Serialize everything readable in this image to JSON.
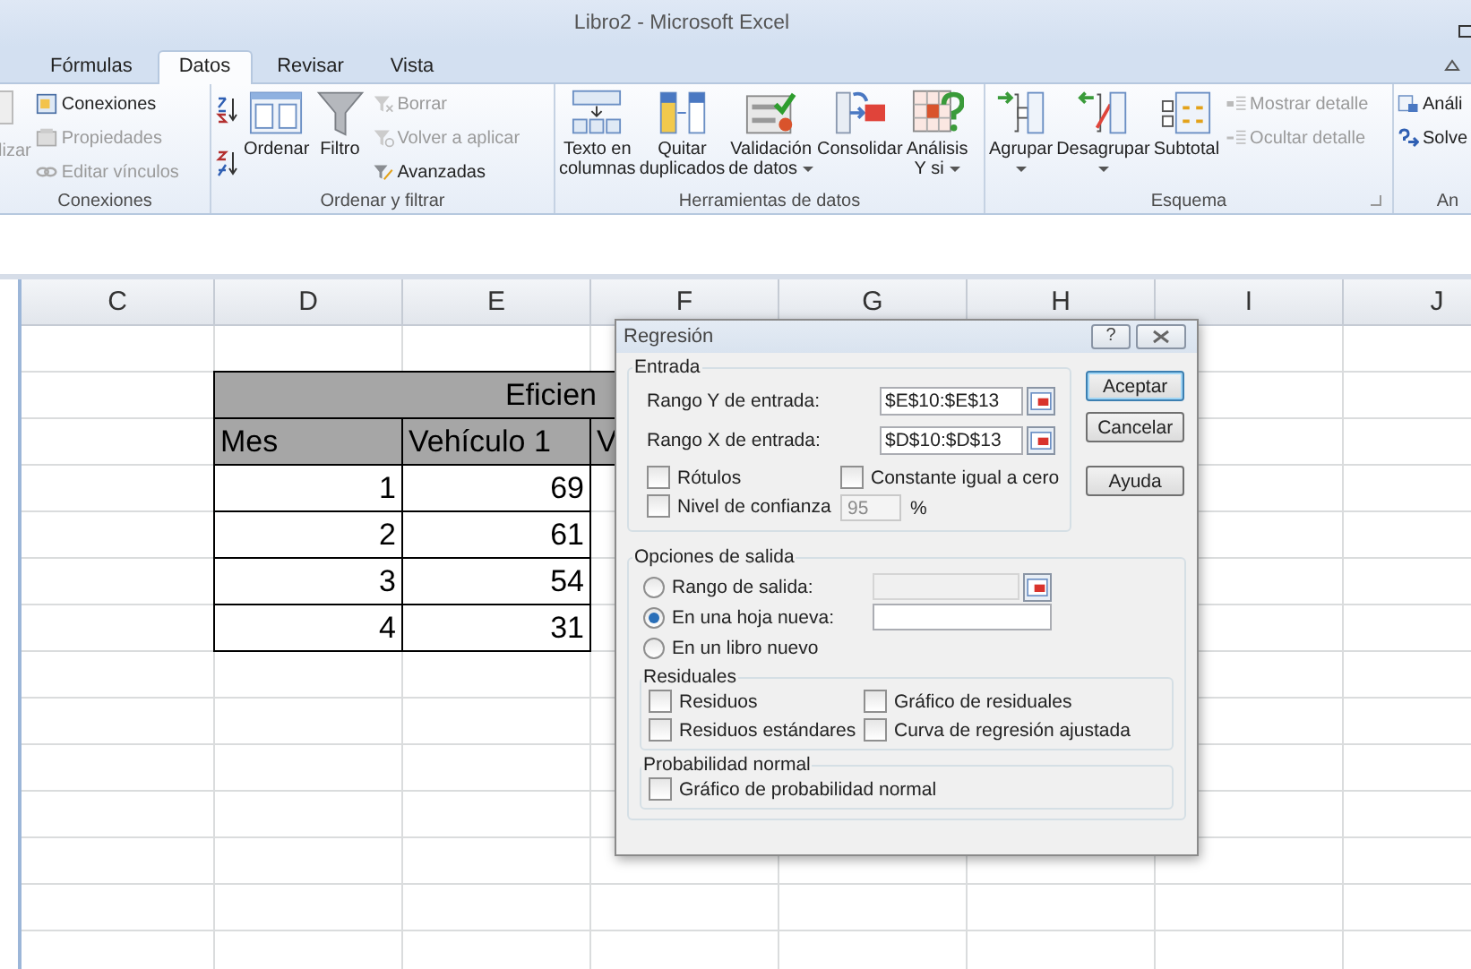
{
  "window": {
    "title": "Libro2  -  Microsoft Excel"
  },
  "tabs": [
    {
      "label": "Fórmulas",
      "selected": false
    },
    {
      "label": "Datos",
      "selected": true
    },
    {
      "label": "Revisar",
      "selected": false
    },
    {
      "label": "Vista",
      "selected": false
    }
  ],
  "ribbon": {
    "groups": [
      {
        "label": "Conexiones",
        "items": [
          {
            "kind": "cut",
            "label": "lizar"
          },
          {
            "kind": "small",
            "label": "Conexiones",
            "disabled": false
          },
          {
            "kind": "small",
            "label": "Propiedades",
            "disabled": true
          },
          {
            "kind": "small",
            "label": "Editar vínculos",
            "disabled": true
          }
        ]
      },
      {
        "label": "Ordenar y filtrar",
        "items": [
          {
            "kind": "sort"
          },
          {
            "kind": "large",
            "label": "Ordenar",
            "dropdown": false
          },
          {
            "kind": "large",
            "label": "Filtro",
            "dropdown": false
          },
          {
            "kind": "small",
            "label": "Borrar",
            "disabled": true
          },
          {
            "kind": "small",
            "label": "Volver a aplicar",
            "disabled": true
          },
          {
            "kind": "small",
            "label": "Avanzadas",
            "disabled": false
          }
        ]
      },
      {
        "label": "Herramientas de datos",
        "items": [
          {
            "kind": "large",
            "label": "Texto en\ncolumnas",
            "dropdown": false
          },
          {
            "kind": "large",
            "label": "Quitar\nduplicados",
            "dropdown": false
          },
          {
            "kind": "large",
            "label": "Validación\nde datos",
            "dropdown": true
          },
          {
            "kind": "large",
            "label": "Consolidar",
            "dropdown": false
          },
          {
            "kind": "large",
            "label": "Análisis\nY si",
            "dropdown": true
          }
        ]
      },
      {
        "label": "Esquema",
        "launcher": true,
        "items": [
          {
            "kind": "large",
            "label": "Agrupar",
            "dropdown": true
          },
          {
            "kind": "large",
            "label": "Desagrupar",
            "dropdown": true
          },
          {
            "kind": "large",
            "label": "Subtotal",
            "dropdown": false
          },
          {
            "kind": "small",
            "label": "Mostrar detalle",
            "disabled": true
          },
          {
            "kind": "small",
            "label": "Ocultar detalle",
            "disabled": true
          }
        ]
      },
      {
        "label": "An",
        "items": [
          {
            "kind": "small",
            "label": "Análi",
            "disabled": false
          },
          {
            "kind": "small",
            "label": "Solve",
            "disabled": false
          }
        ]
      }
    ]
  },
  "sheet": {
    "columns": [
      "C",
      "D",
      "E",
      "F",
      "G",
      "H",
      "I",
      "J"
    ],
    "table": {
      "title": "Eficien",
      "headers": [
        "Mes",
        "Vehículo 1",
        "V"
      ],
      "rows": [
        [
          "1",
          "69"
        ],
        [
          "2",
          "61"
        ],
        [
          "3",
          "54"
        ],
        [
          "4",
          "31"
        ]
      ]
    }
  },
  "dialog": {
    "title": "Regresión",
    "help": "?",
    "input": {
      "label": "Entrada",
      "ranges": [
        {
          "label": "Rango Y de entrada:",
          "value": "$E$10:$E$13"
        },
        {
          "label": "Rango X de entrada:",
          "value": "$D$10:$D$13"
        }
      ],
      "options": [
        {
          "label": "Rótulos",
          "checked": false
        },
        {
          "label": "Constante igual a cero",
          "checked": false
        },
        {
          "label": "Nivel de confianza",
          "checked": false
        }
      ],
      "confidence": {
        "value": "95",
        "disabled": true,
        "unit": "%"
      }
    },
    "buttons": [
      {
        "label": "Aceptar",
        "default": true
      },
      {
        "label": "Cancelar",
        "default": false
      },
      {
        "label": "Ayuda",
        "default": false
      }
    ],
    "output": {
      "label": "Opciones de salida",
      "choices": [
        {
          "label": "Rango de salida:",
          "selected": false,
          "kind": "range",
          "disabled": true
        },
        {
          "label": "En una hoja nueva:",
          "selected": true,
          "kind": "text",
          "disabled": false
        },
        {
          "label": "En un libro nuevo",
          "selected": false
        }
      ],
      "residuals": {
        "label": "Residuales",
        "options": [
          {
            "label": "Residuos",
            "checked": false
          },
          {
            "label": "Gráfico de residuales",
            "checked": false
          },
          {
            "label": "Residuos estándares",
            "checked": false
          },
          {
            "label": "Curva de regresión ajustada",
            "checked": false
          }
        ]
      },
      "normal": {
        "label": "Probabilidad normal",
        "options": [
          {
            "label": "Gráfico de probabilidad normal",
            "checked": false
          }
        ]
      }
    }
  }
}
